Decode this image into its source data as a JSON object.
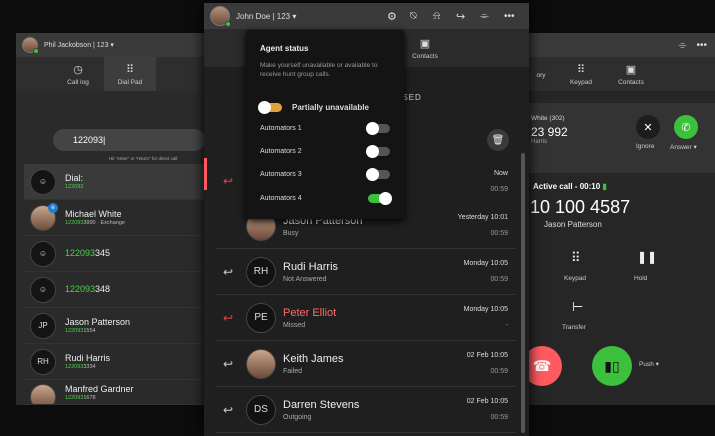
{
  "left": {
    "header": {
      "user": "Phil Jackobson | 123 ▾"
    },
    "tabs": [
      {
        "label": "Call log",
        "icon": "clock-icon"
      },
      {
        "label": "Dial Pad",
        "icon": "dialpad-icon"
      }
    ],
    "search_value": "122093|",
    "hint": "Hit \"enter\" or \"return\" for direct call",
    "rows": [
      {
        "avatar": "☺",
        "name": "Dial:",
        "sub": "122093"
      },
      {
        "avatar": "",
        "name": "Michael White",
        "sub_green": "122093",
        "sub_rest": "3990 · Exchange"
      },
      {
        "avatar": "☺",
        "name_green": "122093",
        "name_rest": "345"
      },
      {
        "avatar": "☺",
        "name_green": "122093",
        "name_rest": "348"
      },
      {
        "avatar": "JP",
        "name": "Jason Patterson",
        "sub_green": "122093",
        "sub_rest": "1554"
      },
      {
        "avatar": "RH",
        "name": "Rudi Harris",
        "sub_green": "122093",
        "sub_rest": "3334"
      },
      {
        "avatar": "",
        "name": "Manfred Gardner",
        "sub_green": "122093",
        "sub_rest": "1678"
      }
    ]
  },
  "center": {
    "header": {
      "user": "John Doe | 123 ▾"
    },
    "tabs": [
      {
        "label": "Contacts",
        "icon": "contacts-icon"
      }
    ],
    "missed_label": "SSED",
    "calls": [
      {
        "initials": "",
        "name": "",
        "status": "",
        "date": "Now",
        "duration": "00:59",
        "missed": true
      },
      {
        "initials": "",
        "name": "Jason Patterson",
        "status": "Busy",
        "date": "Yesterday 10:01",
        "duration": "00:59",
        "missed": false
      },
      {
        "initials": "RH",
        "name": "Rudi Harris",
        "status": "Not Answered",
        "date": "Monday 10:05",
        "duration": "00:59",
        "missed": false
      },
      {
        "initials": "PE",
        "name": "Peter Elliot",
        "status": "Missed",
        "date": "Monday 10:05",
        "duration": "-",
        "missed": true
      },
      {
        "initials": "",
        "name": "Keith James",
        "status": "Failed",
        "date": "02 Feb 10:05",
        "duration": "00:59",
        "missed": false
      },
      {
        "initials": "DS",
        "name": "Darren Stevens",
        "status": "Outgoing",
        "date": "02 Feb 10:05",
        "duration": "00:59",
        "missed": false
      }
    ]
  },
  "popup": {
    "title": "Agent status",
    "description": "Make yourself unavailable or available to receive hunt group calls.",
    "main_toggle": "Partially unavailable",
    "automators": [
      {
        "label": "Automators 1",
        "on": false
      },
      {
        "label": "Automators 2",
        "on": false
      },
      {
        "label": "Automators 3",
        "on": false
      },
      {
        "label": "Automators 4",
        "on": true
      }
    ]
  },
  "right": {
    "tabs": [
      {
        "label": "ory"
      },
      {
        "label": "Keypad"
      },
      {
        "label": "Contacts"
      }
    ],
    "incoming": {
      "name": "White (302)",
      "number": "23 992",
      "sub": "Harris",
      "ignore": "Ignore",
      "answer": "Answer ▾"
    },
    "active_label": "Active call - 00:10",
    "number": "10 100 4587",
    "contact": "Jason Patterson",
    "keypad": "Keypad",
    "hold": "Hold",
    "transfer": "Transfer",
    "push": "Push ▾"
  },
  "colors": {
    "green": "#3cc13c",
    "red": "#ff5a5f",
    "accent_orange": "#e0a23c"
  }
}
